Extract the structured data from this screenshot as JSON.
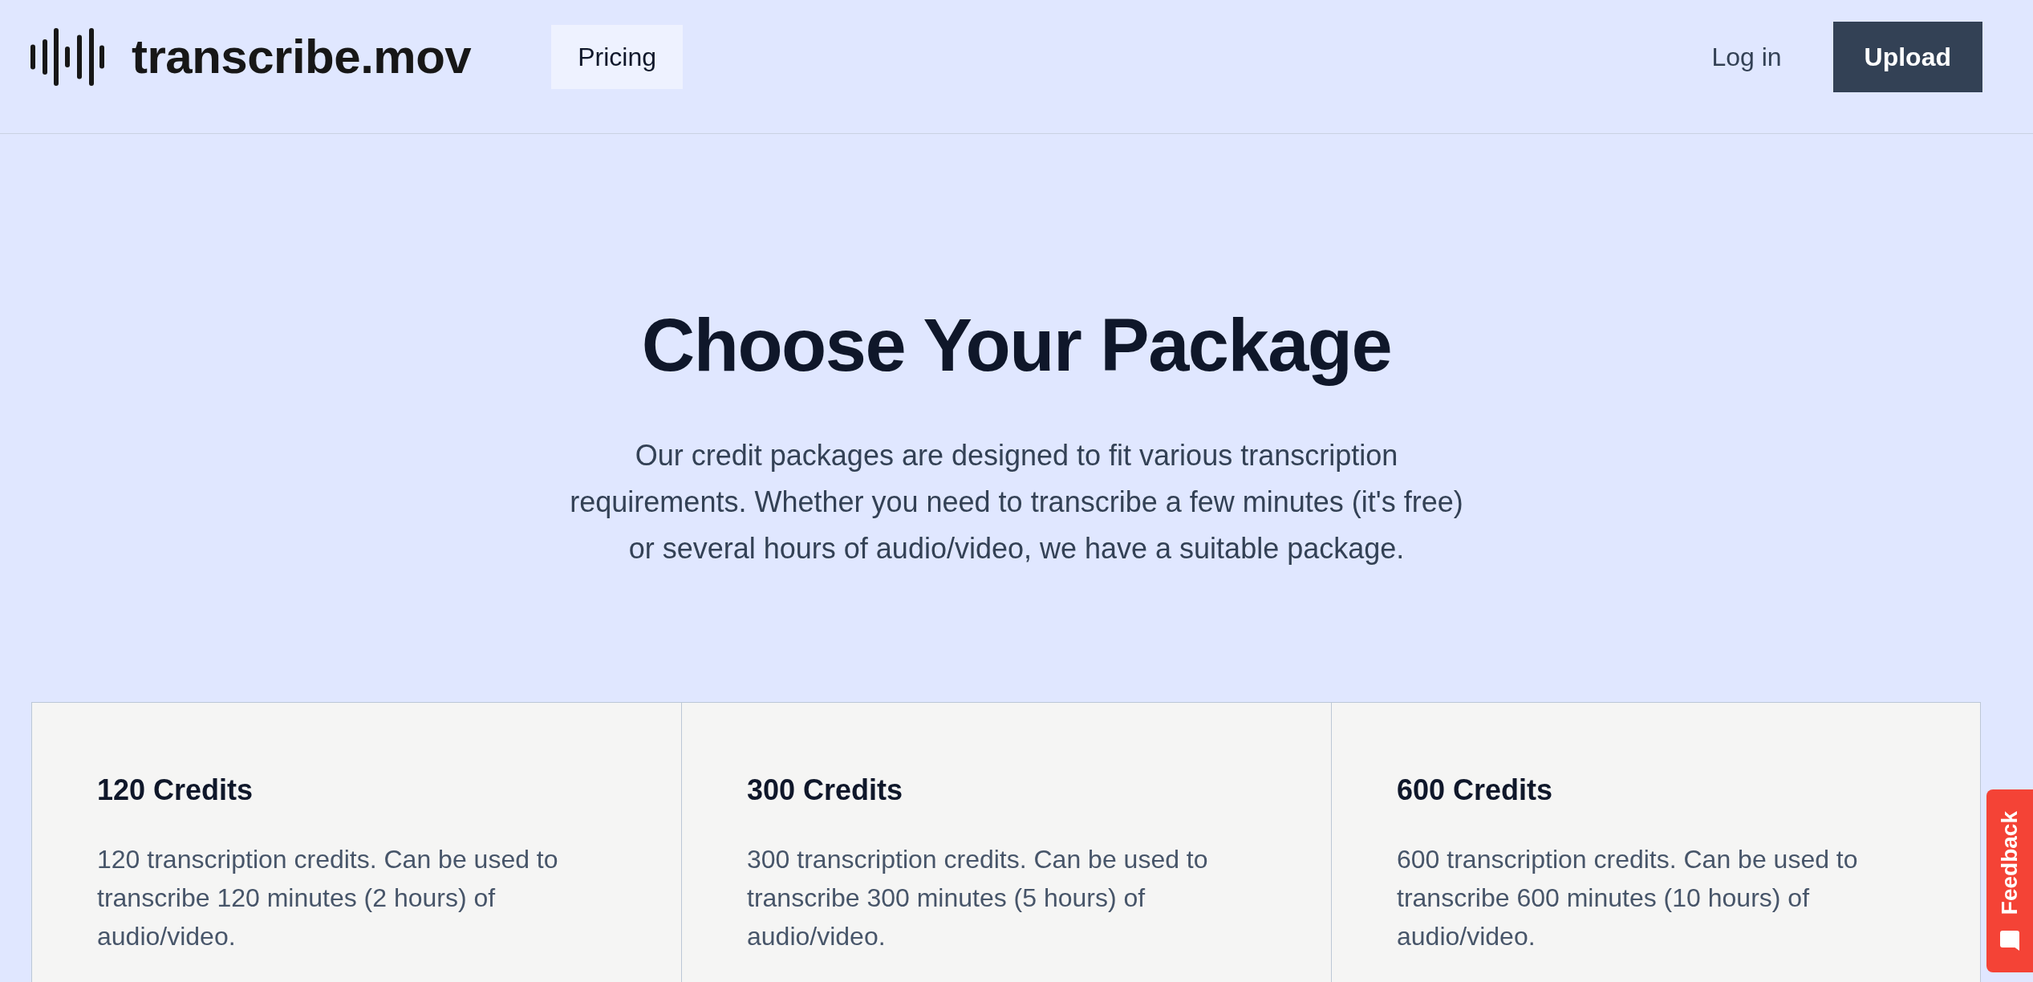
{
  "header": {
    "logo": {
      "text": "transcribe.mov"
    },
    "nav": [
      {
        "label": "Pricing",
        "selected": true
      }
    ],
    "login": "Log in",
    "upload": "Upload"
  },
  "hero": {
    "title": "Choose Your Package",
    "description": "Our credit packages are designed to fit various transcription requirements. Whether you need to transcribe a few minutes (it's free) or several hours of audio/video, we have a suitable package."
  },
  "packages": [
    {
      "title": "120 Credits",
      "description": "120 transcription credits. Can be used to transcribe 120 minutes (2 hours) of audio/video."
    },
    {
      "title": "300 Credits",
      "description": "300 transcription credits. Can be used to transcribe 300 minutes (5 hours) of audio/video."
    },
    {
      "title": "600 Credits",
      "description": "600 transcription credits. Can be used to transcribe 600 minutes (10 hours) of audio/video."
    }
  ],
  "feedback_tab": {
    "label": "Feedback"
  }
}
